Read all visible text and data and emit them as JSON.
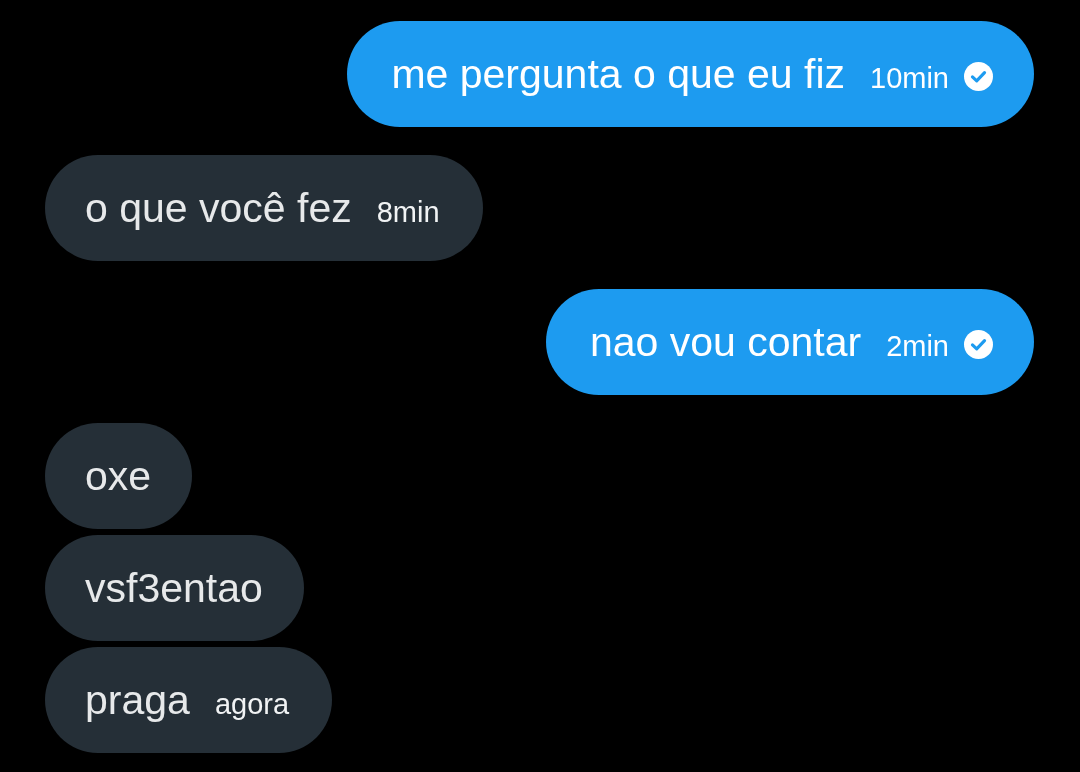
{
  "messages": [
    {
      "kind": "sent",
      "text": "me pergunta o que eu fiz",
      "time": "10min",
      "read": true
    },
    {
      "kind": "received",
      "text": "o que você fez",
      "time": "8min"
    },
    {
      "kind": "sent",
      "text": "nao vou contar",
      "time": "2min",
      "read": true
    },
    {
      "kind": "received",
      "text": "oxe"
    },
    {
      "kind": "received",
      "text": "vsf3entao"
    },
    {
      "kind": "received",
      "text": "praga",
      "time": "agora"
    }
  ]
}
